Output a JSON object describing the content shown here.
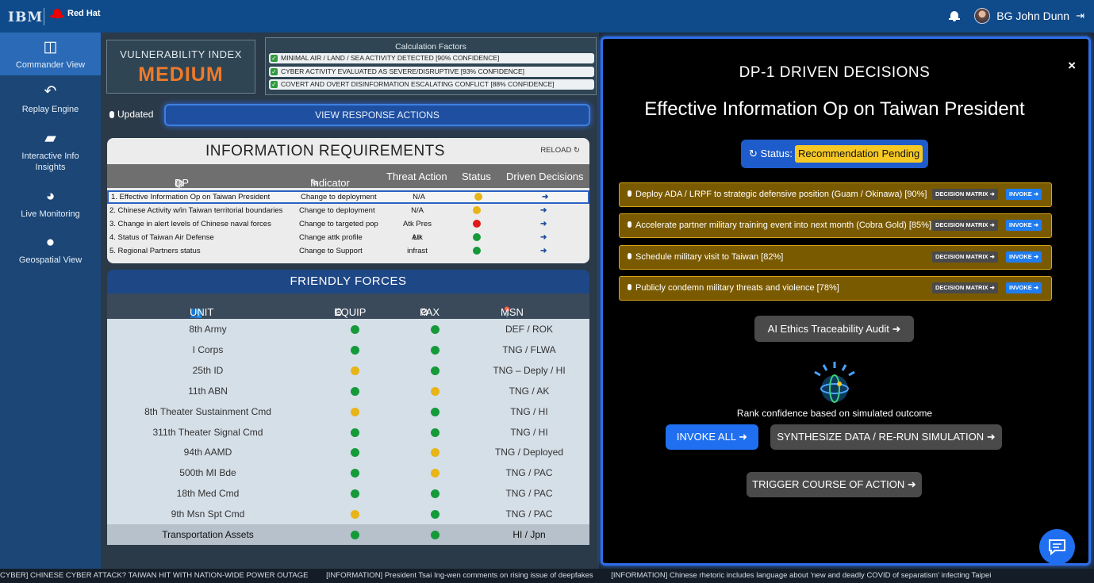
{
  "topbar": {
    "ibm_logo": "IBM",
    "redhat_logo": "Red Hat",
    "user_name": "BG John Dunn"
  },
  "sidebar": {
    "items": [
      {
        "label": "Commander View",
        "icon": "panel-icon"
      },
      {
        "label": "Replay Engine",
        "icon": "replay-icon"
      },
      {
        "label": "Interactive Info Insights",
        "icon": "folder-icon"
      },
      {
        "label": "Live Monitoring",
        "icon": "dashboard-icon"
      },
      {
        "label": "Geospatial View",
        "icon": "globe-icon"
      }
    ]
  },
  "vulnerability": {
    "label": "VULNERABILITY INDEX",
    "value": "MEDIUM",
    "value_color": "#f07a28"
  },
  "calculation": {
    "title": "Calculation Factors",
    "items": [
      "MINIMAL AIR / LAND / SEA ACTIVITY DETECTED [90% CONFIDENCE]",
      "CYBER ACTIVITY EVALUATED AS SEVERE/DISRUPTIVE [93% CONFIDENCE]",
      "COVERT AND OVERT DISINFORMATION ESCALATING CONFLICT [88% CONFIDENCE]"
    ]
  },
  "updated_label": "Updated",
  "view_response_label": "VIEW RESPONSE ACTIONS",
  "info_requirements": {
    "title": "INFORMATION REQUIREMENTS",
    "reload": "RELOAD",
    "headers": {
      "dp": "DP (Map)",
      "indicator": "Indicator",
      "threat": "Threat Action",
      "status": "Status",
      "driven": "Driven Decisions"
    },
    "rows": [
      {
        "dp": "1. Effective Information Op on Taiwan President",
        "indicator": "Change to deployment",
        "threat": "N/A",
        "status": "yellow"
      },
      {
        "dp": "2. Chinese Activity w/in Taiwan territorial boundaries",
        "indicator": "Change to deployment",
        "threat": "N/A",
        "status": "yellow"
      },
      {
        "dp": "3. Change in alert levels of Chinese naval forces",
        "indicator": "Change to targeted pop",
        "threat": "Atk Pres Lir",
        "status": "red"
      },
      {
        "dp": "4. Status of Taiwan Air Defense",
        "indicator": "Change attk profile",
        "threat": "Atk infrast",
        "status": "green"
      },
      {
        "dp": "5. Regional Partners status",
        "indicator": "Change to Support",
        "threat": "",
        "status": "green"
      }
    ],
    "arrow": "➜"
  },
  "friendly_forces": {
    "title": "FRIENDLY FORCES",
    "headers": {
      "unit": "UNIT",
      "equip": "EQUIP",
      "pax": "PAX",
      "msn": "MSN / LOC"
    },
    "rows": [
      {
        "unit": "8th Army",
        "equip": "green",
        "pax": "green",
        "msn": "DEF / ROK"
      },
      {
        "unit": "I Corps",
        "equip": "green",
        "pax": "green",
        "msn": "TNG / FLWA"
      },
      {
        "unit": "25th ID",
        "equip": "yellow",
        "pax": "green",
        "msn": "TNG – Deply / HI"
      },
      {
        "unit": "11th ABN",
        "equip": "green",
        "pax": "yellow",
        "msn": "TNG / AK"
      },
      {
        "unit": "8th Theater Sustainment Cmd",
        "equip": "yellow",
        "pax": "green",
        "msn": "TNG / HI"
      },
      {
        "unit": "311th Theater Signal Cmd",
        "equip": "green",
        "pax": "green",
        "msn": "TNG / HI"
      },
      {
        "unit": "94th AAMD",
        "equip": "green",
        "pax": "yellow",
        "msn": "TNG / Deployed"
      },
      {
        "unit": "500th MI Bde",
        "equip": "green",
        "pax": "yellow",
        "msn": "TNG / PAC"
      },
      {
        "unit": "18th Med Cmd",
        "equip": "green",
        "pax": "green",
        "msn": "TNG / PAC"
      },
      {
        "unit": "9th Msn Spt Cmd",
        "equip": "yellow",
        "pax": "green",
        "msn": "TNG / PAC"
      },
      {
        "unit": "Transportation Assets",
        "equip": "green",
        "pax": "green",
        "msn": "HI / Jpn"
      }
    ]
  },
  "decisions": {
    "heading": "DP-1 DRIVEN DECISIONS",
    "op_title": "Effective Information Op on Taiwan President",
    "status_label": "Status:",
    "status_value": "Recommendation Pending",
    "items": [
      "Deploy ADA / LRPF to strategic defensive position (Guam / Okinawa) [90%]",
      "Accelerate partner military training event into next month (Cobra Gold) [85%]",
      "Schedule military visit to Taiwan [82%]",
      "Publicly condemn military threats and violence [78%]"
    ],
    "matrix_label": "DECISION MATRIX ➜",
    "invoke_label": "INVOKE ➜",
    "audit_label": "AI Ethics Traceability Audit ➜",
    "rank_text": "Rank confidence based on simulated outcome",
    "invoke_all_label": "INVOKE ALL ➜",
    "synthesize_label": "SYNTHESIZE DATA / RE-RUN SIMULATION ➜",
    "trigger_label": "TRIGGER COURSE OF ACTION ➜",
    "close": "×"
  },
  "ticker": [
    "CYBER] CHINESE CYBER ATTACK? TAIWAN HIT WITH NATION-WIDE POWER OUTAGE",
    "[INFORMATION] President Tsai Ing-wen comments on rising issue of deepfakes",
    "[INFORMATION] Chinese rhetoric includes language about 'new and deadly COVID of separatism' infecting Taipei"
  ]
}
